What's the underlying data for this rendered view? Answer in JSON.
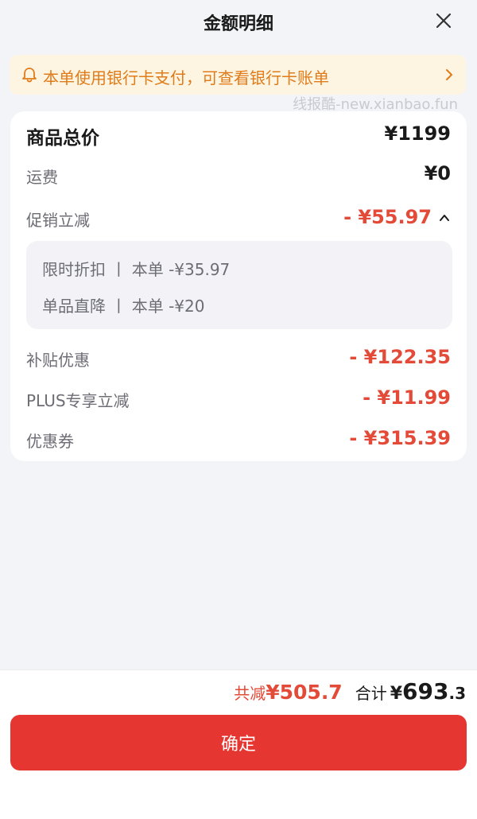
{
  "header": {
    "title": "金额明细",
    "close_icon": "close-icon"
  },
  "notice": {
    "text": "本单使用银行卡支付，可查看银行卡账单",
    "icon": "bell-icon",
    "chevron": "chevron-right-icon"
  },
  "watermark": "线报酷-new.xianbao.fun",
  "details": {
    "total_label": "商品总价",
    "total_value": "¥1199",
    "shipping_label": "运费",
    "shipping_value": "¥0",
    "promo_label": "促销立减",
    "promo_value": "- ¥55.97",
    "promo_items": [
      {
        "text": "限时折扣 丨 本单 -¥35.97"
      },
      {
        "text": "单品直降 丨 本单 -¥20"
      }
    ],
    "subsidy_label": "补贴优惠",
    "subsidy_value": "- ¥122.35",
    "plus_label": "PLUS专享立减",
    "plus_value": "- ¥11.99",
    "coupon_label": "优惠券",
    "coupon_value": "- ¥315.39"
  },
  "footer": {
    "saved_label": "共减",
    "saved_value": "¥505.7",
    "total_label": "合计",
    "currency": "¥",
    "total_int": "693",
    "total_dec": ".3",
    "confirm_label": "确定"
  },
  "colors": {
    "accent_red": "#e63631",
    "notice_bg": "#fdf5e2",
    "notice_text": "#e07b1a"
  }
}
